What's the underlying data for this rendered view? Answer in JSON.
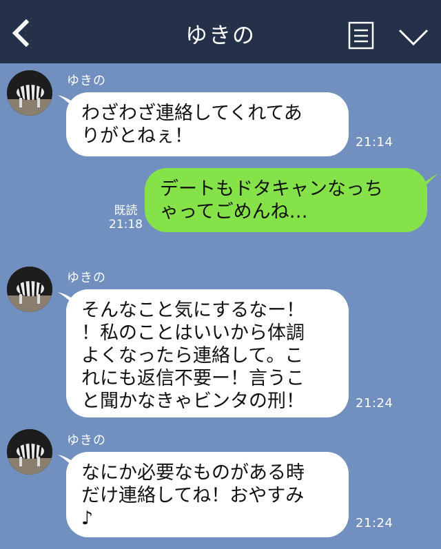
{
  "header": {
    "title": "ゆきの",
    "icons": [
      "chevron-left-icon",
      "note-icon",
      "chevron-down-icon"
    ]
  },
  "colors": {
    "background": "#7190bf",
    "header": "#243149",
    "incoming_bubble": "#ffffff",
    "outgoing_bubble": "#85e249"
  },
  "messages": [
    {
      "direction": "incoming",
      "sender": "ゆきの",
      "text": "わざわざ連絡してくれてあ\nりがとねぇ！",
      "time": "21:14"
    },
    {
      "direction": "outgoing",
      "text": "デートもドタキャンなっち\nゃってごめんね…",
      "read": "既読",
      "time": "21:18"
    },
    {
      "direction": "incoming",
      "sender": "ゆきの",
      "text": "そんなこと気にするなー！\n！私のことはいいから体調\nよくなったら連絡して。こ\nれにも返信不要ー！言うこ\nと聞かなきゃビンタの刑！",
      "time": "21:24"
    },
    {
      "direction": "incoming",
      "sender": "ゆきの",
      "text": "なにか必要なものがある時\nだけ連絡してね！おやすみ\n♪",
      "time": "21:24"
    }
  ]
}
